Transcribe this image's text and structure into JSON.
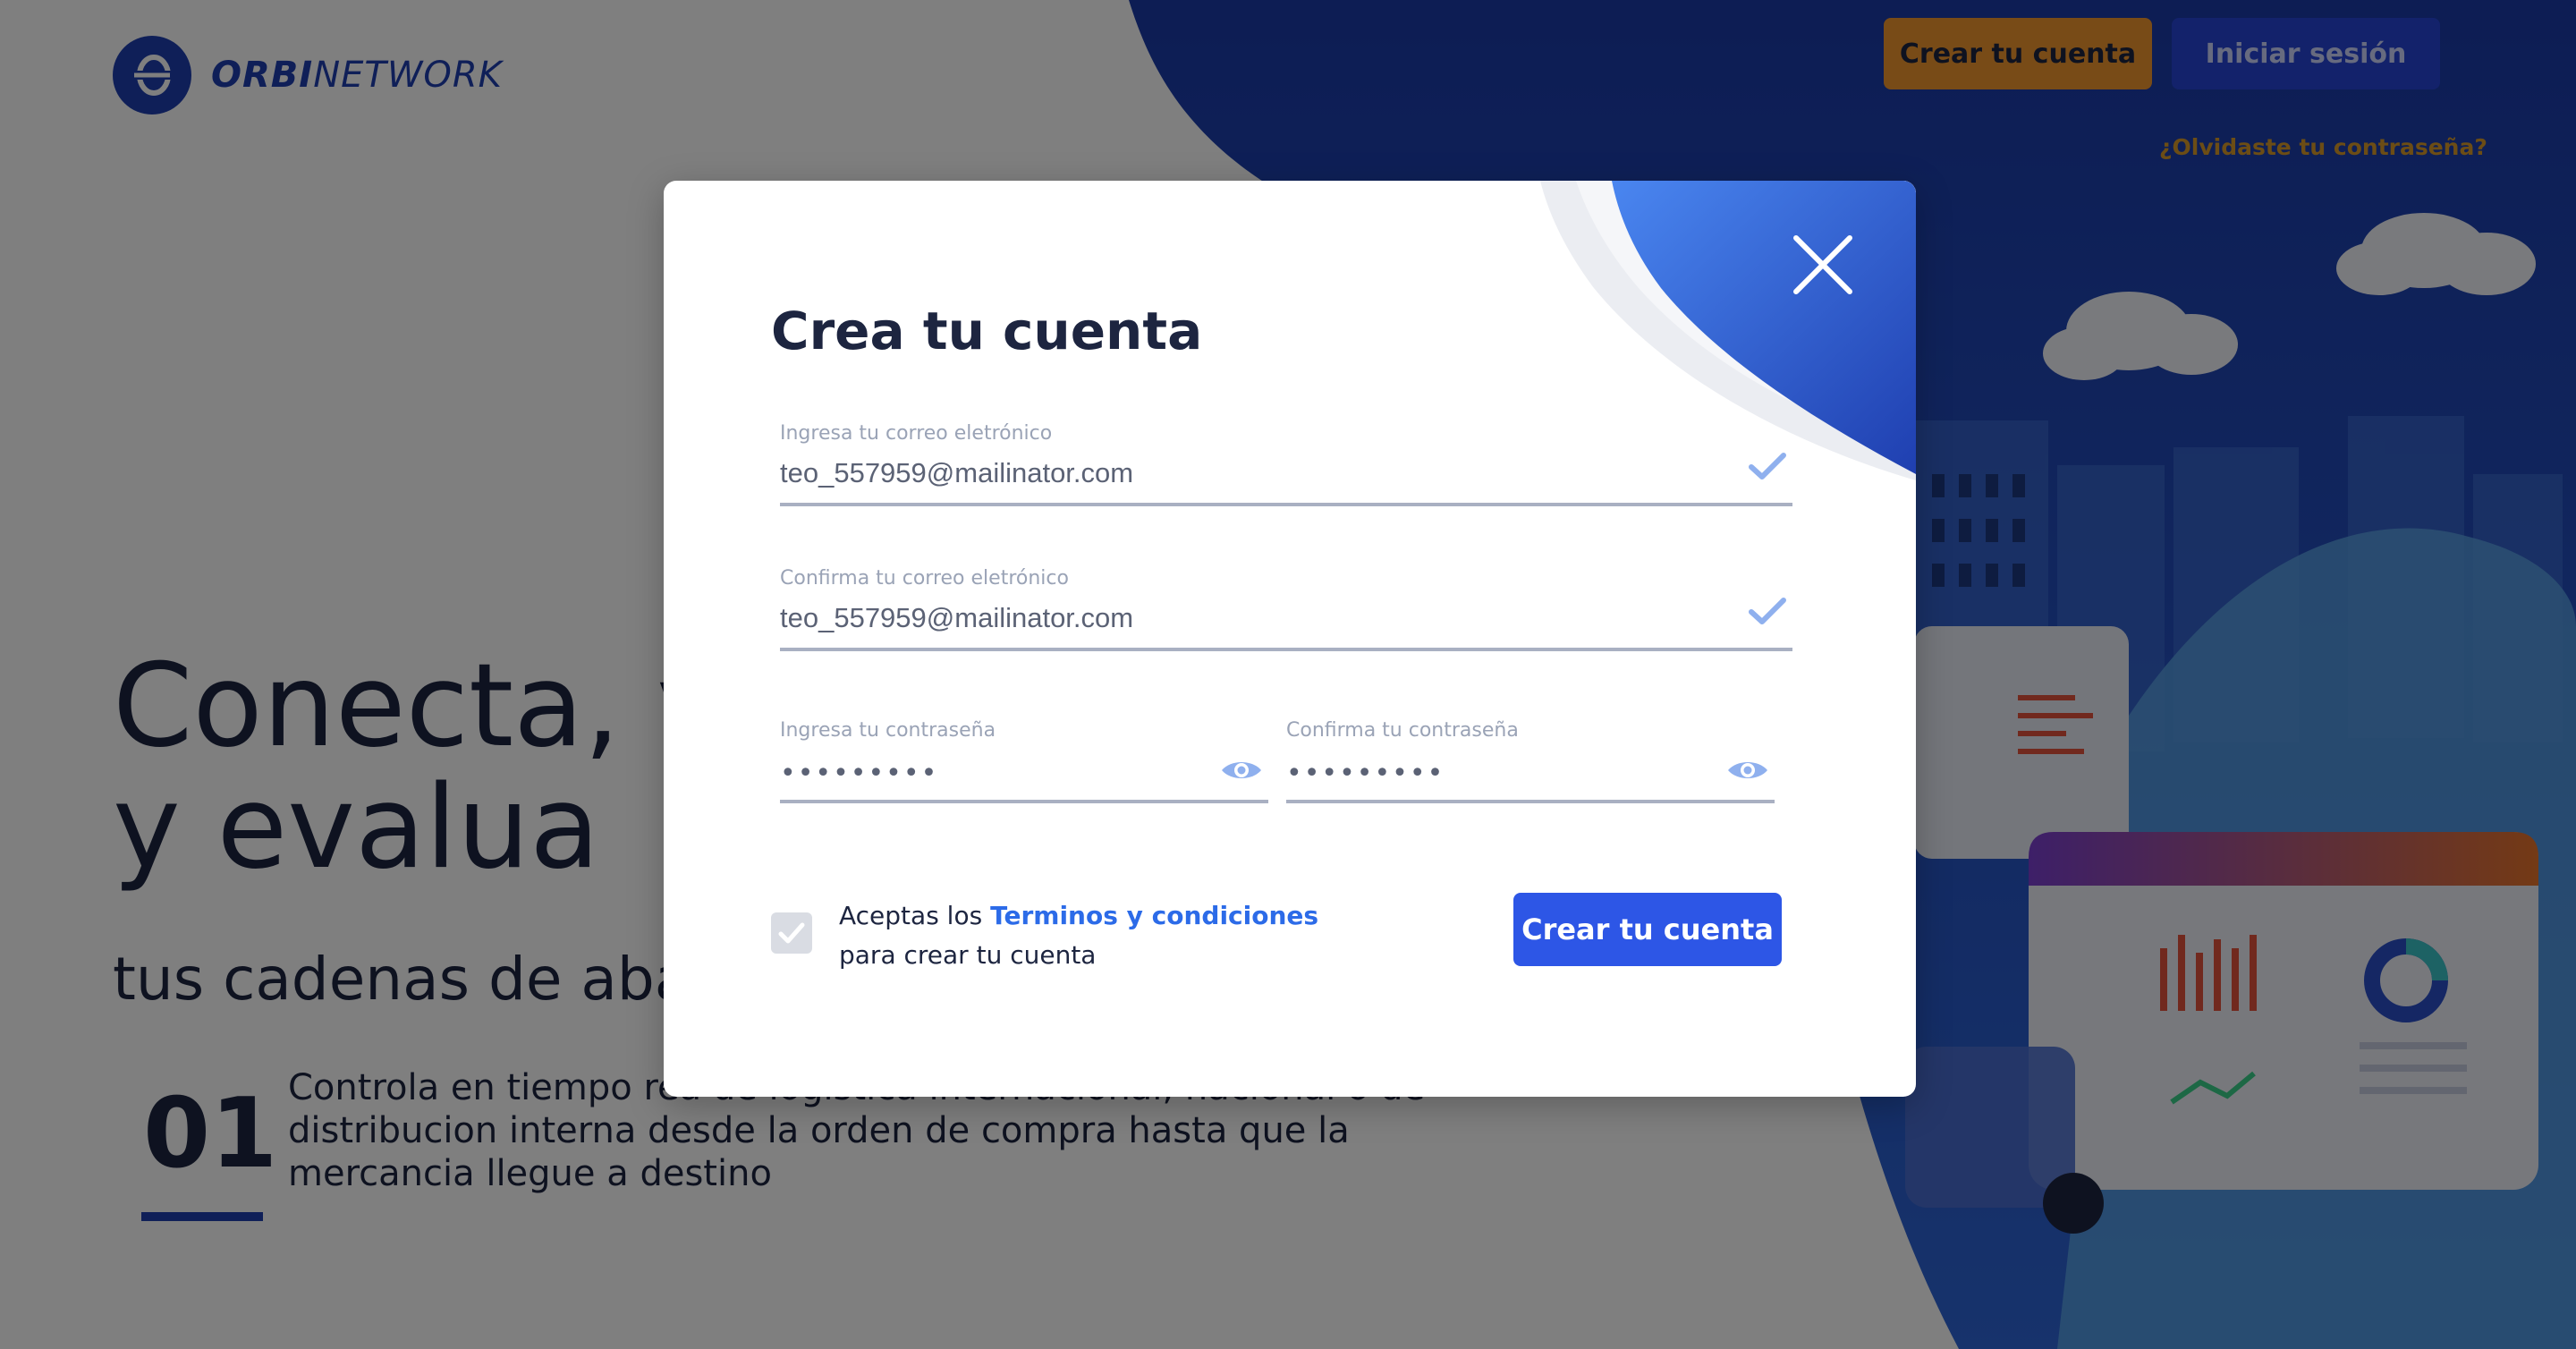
{
  "header": {
    "logo_text_bold": "ORBI",
    "logo_text_light": "NETWORK",
    "register_label": "Crear tu cuenta",
    "login_label": "Iniciar sesión",
    "forgot_label": "¿Olvidaste tu contraseña?"
  },
  "hero": {
    "headline_line1": "Conecta, v",
    "headline_line2": "y evalua",
    "subhead": "tus cadenas de abas",
    "step_number": "01",
    "step_text": "Controla en tiempo rea               de logística internacional, nacional o de distribucion interna desde la orden de compra hasta que la mercancia llegue a destino"
  },
  "modal": {
    "title": "Crea tu cuenta",
    "email_label": "Ingresa tu correo eletrónico",
    "email_value": "teo_557959@mailinator.com",
    "confirm_email_label": "Confirma tu correo eletrónico",
    "confirm_email_value": "teo_557959@mailinator.com",
    "password_label": "Ingresa tu contraseña",
    "password_value": "•••••••••",
    "confirm_password_label": "Confirma tu contraseña",
    "confirm_password_value": "•••••••••",
    "terms_prefix": "Aceptas los ",
    "terms_link": "Terminos y condiciones",
    "terms_suffix": "para crear tu cuenta",
    "terms_checked": true,
    "submit_label": "Crear tu cuenta"
  },
  "colors": {
    "brand_blue": "#1f3fb0",
    "accent_orange": "#f0962e",
    "link_blue": "#2c6be8",
    "button_blue": "#2d56e6"
  },
  "icons": {
    "logo": "orbinetwork-logo-icon",
    "close": "close-icon",
    "check": "checkmark-icon",
    "eye": "eye-icon"
  }
}
